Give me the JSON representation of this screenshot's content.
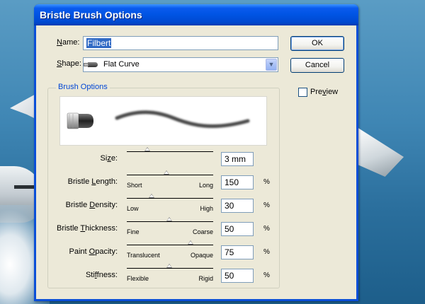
{
  "dialog": {
    "title": "Bristle Brush Options",
    "name_label_pre": "",
    "name_label_u": "N",
    "name_label_post": "ame:",
    "name_value": "Filbert",
    "shape_label_u": "S",
    "shape_label_post": "hape:",
    "shape_value": "Flat Curve",
    "ok_label": "OK",
    "cancel_label": "Cancel",
    "preview_pre": "Pre",
    "preview_u": "v",
    "preview_post": "iew",
    "preview_checked": false,
    "group_label": "Brush Options"
  },
  "controls": [
    {
      "id": "size",
      "label_pre": "Si",
      "label_u": "z",
      "label_post": "e:",
      "value": "3 mm",
      "min_label": "",
      "max_label": "",
      "unit": "",
      "position": 0.24
    },
    {
      "id": "bristle-length",
      "label_pre": "Bristle ",
      "label_u": "L",
      "label_post": "ength:",
      "value": "150",
      "min_label": "Short",
      "max_label": "Long",
      "unit": "%",
      "position": 0.46
    },
    {
      "id": "bristle-density",
      "label_pre": "Bristle ",
      "label_u": "D",
      "label_post": "ensity:",
      "value": "30",
      "min_label": "Low",
      "max_label": "High",
      "unit": "%",
      "position": 0.29
    },
    {
      "id": "bristle-thickness",
      "label_pre": "Bristle ",
      "label_u": "T",
      "label_post": "hickness:",
      "value": "50",
      "min_label": "Fine",
      "max_label": "Coarse",
      "unit": "%",
      "position": 0.49
    },
    {
      "id": "paint-opacity",
      "label_pre": "Paint ",
      "label_u": "O",
      "label_post": "pacity:",
      "value": "75",
      "min_label": "Translucent",
      "max_label": "Opaque",
      "unit": "%",
      "position": 0.74
    },
    {
      "id": "stiffness",
      "label_pre": "Sti",
      "label_u": "f",
      "label_post": "fness:",
      "value": "50",
      "min_label": "Flexible",
      "max_label": "Rigid",
      "unit": "%",
      "position": 0.49
    }
  ]
}
